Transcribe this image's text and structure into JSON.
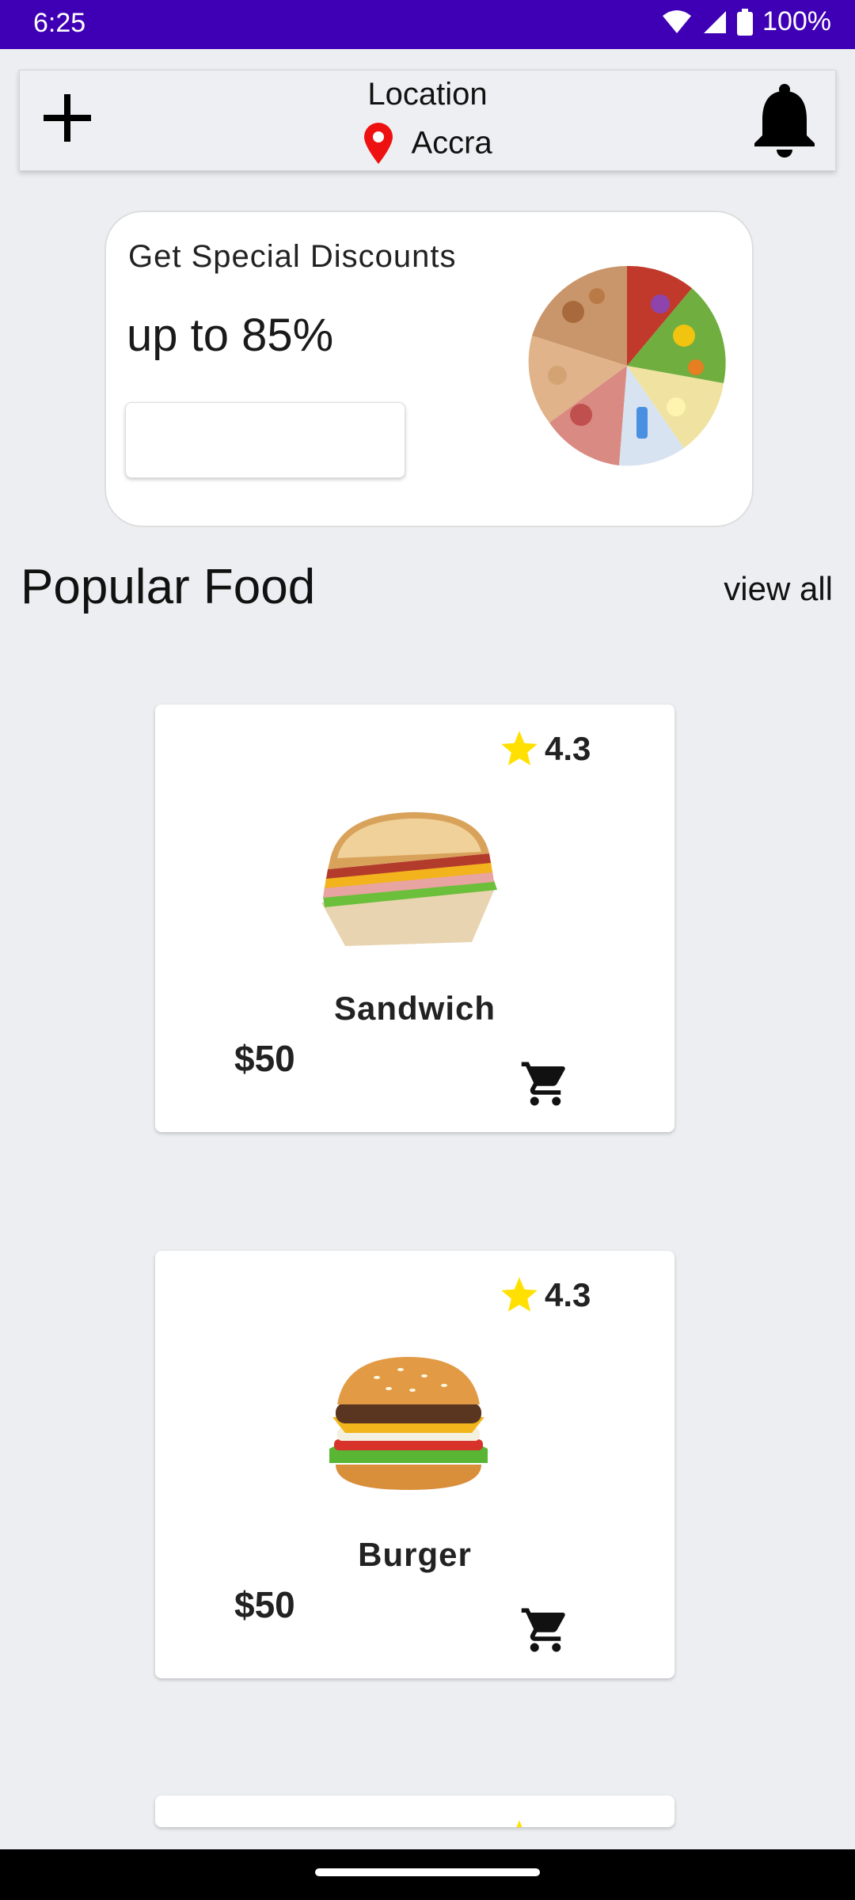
{
  "status_bar": {
    "time": "6:25",
    "battery": "100%"
  },
  "header": {
    "location_title": "Location",
    "location_value": "Accra"
  },
  "promo": {
    "title": "Get Special Discounts",
    "subtitle": "up to 85%",
    "button_label": ""
  },
  "section": {
    "title": "Popular Food",
    "view_all": "view all"
  },
  "foods": [
    {
      "name": "Sandwich",
      "price": "$50",
      "rating": "4.3"
    },
    {
      "name": "Burger",
      "price": "$50",
      "rating": "4.3"
    },
    {
      "name": "",
      "price": "",
      "rating": ""
    }
  ],
  "colors": {
    "status_bar": "#3f00b5",
    "pin": "#ee1111",
    "star": "#ffe000",
    "background": "#eceef1"
  }
}
